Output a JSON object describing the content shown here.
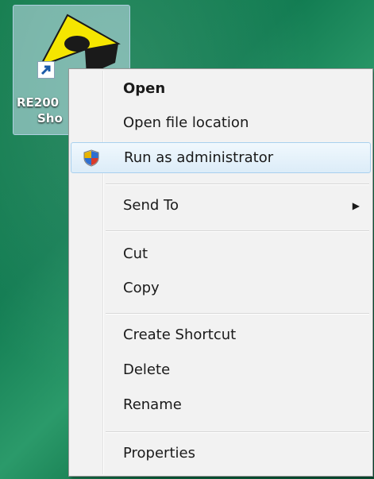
{
  "desktop": {
    "icon": {
      "label_line1": "RE200",
      "label_line2": "Sho"
    }
  },
  "context_menu": {
    "items": [
      {
        "label": "Open",
        "bold": true
      },
      {
        "label": "Open file location"
      },
      {
        "label": "Run as administrator",
        "icon": "uac-shield-icon",
        "highlighted": true
      },
      {
        "label": "Send To",
        "submenu": true
      },
      {
        "label": "Cut"
      },
      {
        "label": "Copy"
      },
      {
        "label": "Create Shortcut"
      },
      {
        "label": "Delete"
      },
      {
        "label": "Rename"
      },
      {
        "label": "Properties"
      }
    ],
    "submenu_arrow": "▶"
  },
  "colors": {
    "desktop": "#127c52",
    "menu_bg": "#f2f2f2",
    "highlight_border": "#a8d0ee"
  }
}
